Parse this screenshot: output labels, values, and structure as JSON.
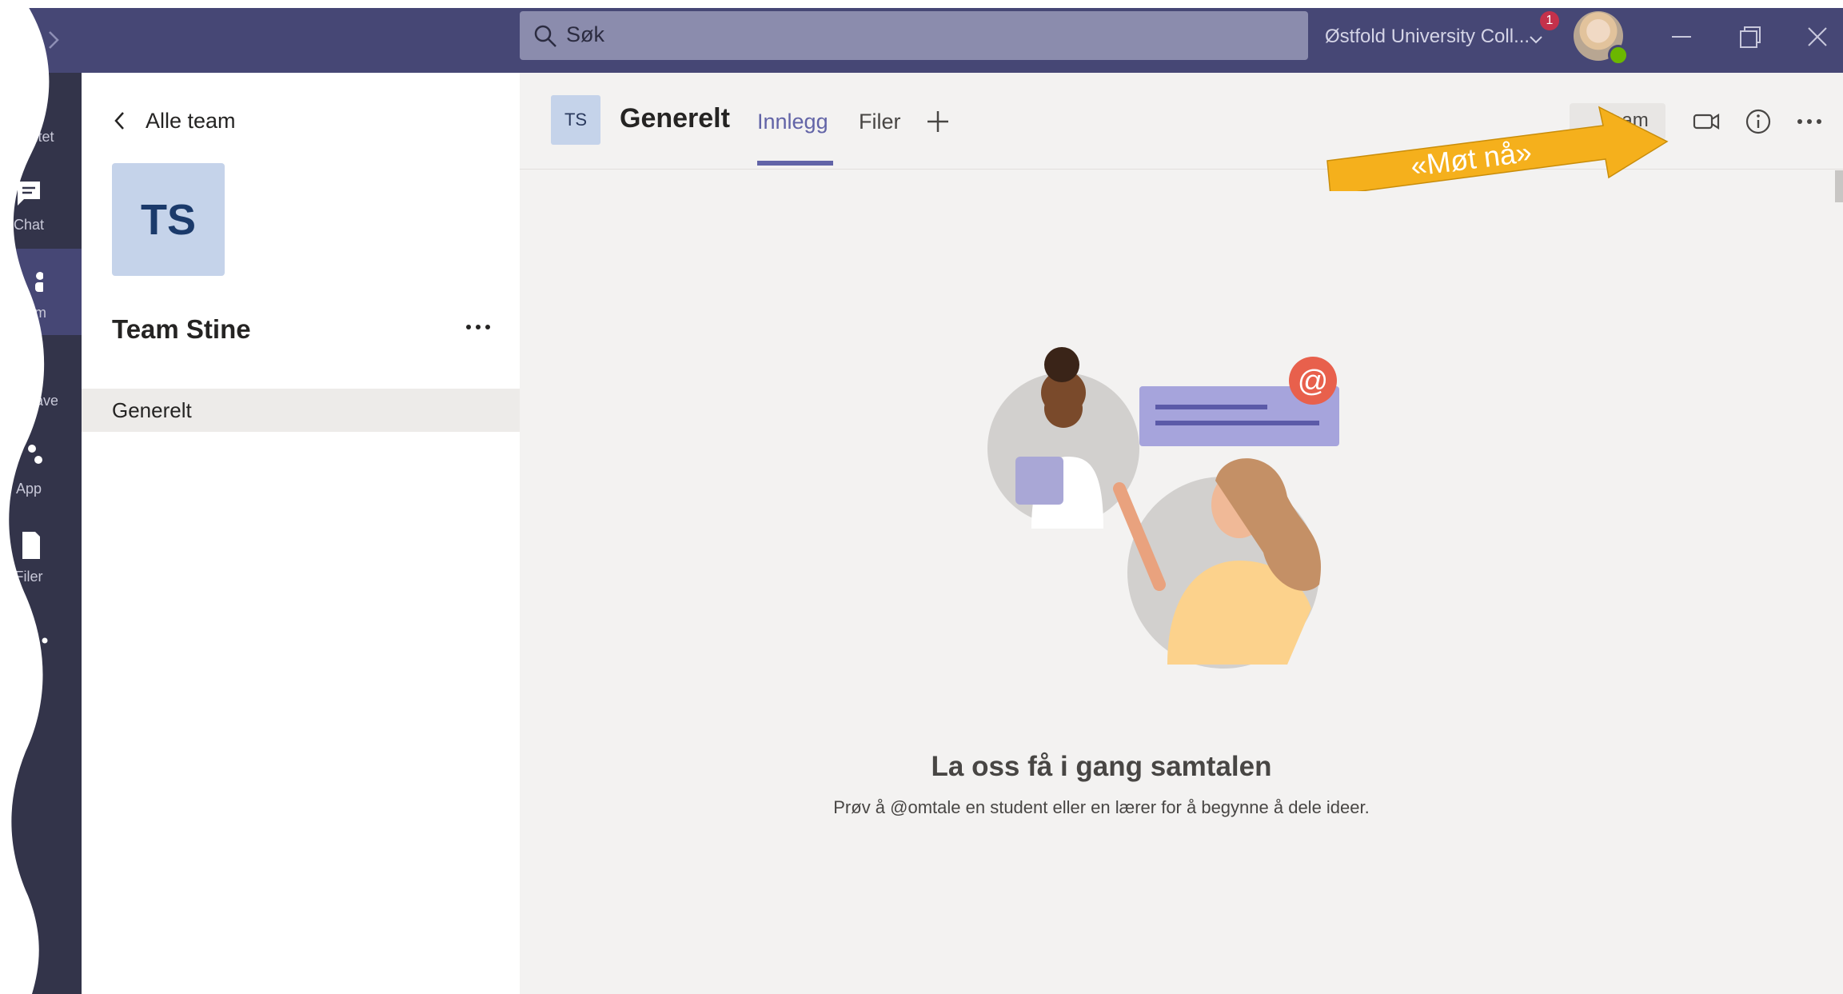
{
  "topbar": {
    "search_placeholder": "Søk",
    "org_name": "Østfold University Coll...",
    "notification_count": "1"
  },
  "rail": {
    "items": [
      {
        "label": "Aktivitet",
        "icon": "bell-icon"
      },
      {
        "label": "Chat",
        "icon": "chat-icon"
      },
      {
        "label": "Team",
        "icon": "teams-icon"
      },
      {
        "label": "Oppgaver",
        "icon": "assignments-icon"
      },
      {
        "label": "App",
        "icon": "apps-icon"
      },
      {
        "label": "Filer",
        "icon": "files-icon"
      }
    ]
  },
  "panel": {
    "back_label": "Alle team",
    "team_initials": "TS",
    "team_name": "Team Stine",
    "channels": [
      {
        "label": "Generelt"
      }
    ]
  },
  "main": {
    "channel_initials": "TS",
    "channel_title": "Generelt",
    "tabs": [
      {
        "label": "Innlegg"
      },
      {
        "label": "Filer"
      }
    ],
    "team_button_label": "Team",
    "annotation_label": "«Møt nå»",
    "empty_title": "La oss få i gang samtalen",
    "empty_subtitle": "Prøv å @omtale en student eller en lærer for å begynne å dele ideer."
  },
  "colors": {
    "titlebar": "#464775",
    "rail": "#33344a",
    "accent": "#6264a7",
    "annotation_arrow": "#f5b01c"
  }
}
